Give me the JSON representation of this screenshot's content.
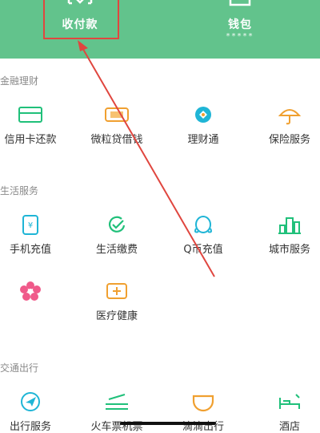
{
  "top": {
    "pay_label": "收付款",
    "wallet_label": "钱包",
    "wallet_sub": "*****"
  },
  "sections": {
    "finance": "金融理财",
    "life": "生活服务",
    "travel": "交通出行"
  },
  "finance_items": [
    "信用卡还款",
    "微粒贷借钱",
    "理财通",
    "保险服务"
  ],
  "life_items": [
    "手机充值",
    "生活缴费",
    "Q币充值",
    "城市服务"
  ],
  "life_items_row2": [
    "",
    "医疗健康"
  ],
  "travel_items": [
    "出行服务",
    "火车票机票",
    "滴滴出行",
    "酒店"
  ],
  "colors": {
    "brand_green": "#62c38c",
    "icon_green": "#20c07a",
    "icon_orange": "#f0a030",
    "icon_teal": "#1fb5d6",
    "icon_pink": "#f05a8a",
    "annotation_red": "#e0463f"
  }
}
